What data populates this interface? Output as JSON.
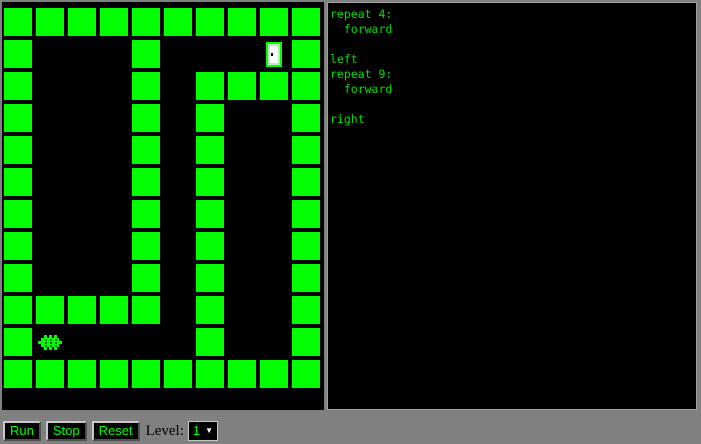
{
  "maze": {
    "rows": [
      "##########",
      "#...#...E#",
      "#...#.####",
      "#...#.#..#",
      "#...#.#..#",
      "#...#.#..#",
      "#...#.#..#",
      "#...#.#..#",
      "#...#.#..#",
      "#####.#..#",
      "#R....#..#",
      "##########"
    ],
    "wall_color": "#00ff00",
    "background_color": "#000000",
    "robot": {
      "row": 10,
      "col": 1,
      "icon": "robot-icon"
    },
    "exit": {
      "row": 1,
      "col": 8,
      "icon": "door-icon"
    }
  },
  "editor": {
    "code": "repeat 4:\n  forward\n\nleft\nrepeat 9:\n  forward\n\nright"
  },
  "controls": {
    "run_label": "Run",
    "stop_label": "Stop",
    "reset_label": "Reset",
    "level_label": "Level:",
    "level_value": "1",
    "dropdown_icon": "chevron-down-icon"
  }
}
